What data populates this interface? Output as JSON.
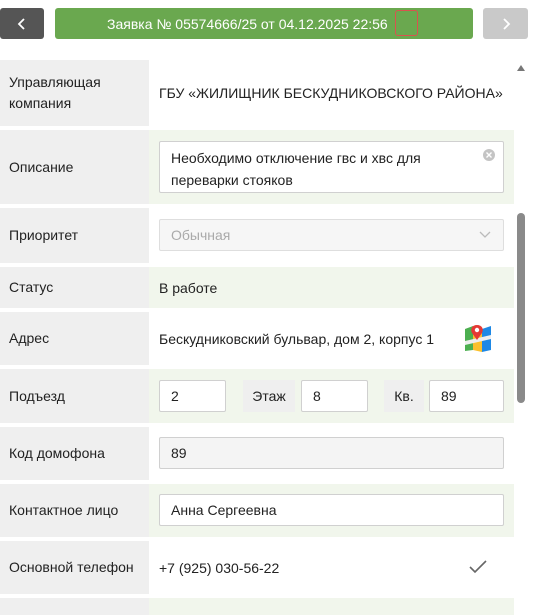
{
  "header": {
    "title": "Заявка № 05574666/25 от 04.12.2025 22:56",
    "back_icon": "chevron-left-icon",
    "forward_icon": "chevron-right-icon"
  },
  "form": {
    "company": {
      "label": "Управляющая компания",
      "value": "ГБУ «ЖИЛИЩНИК БЕСКУДНИКОВСКОГО РАЙОНА»"
    },
    "description": {
      "label": "Описание",
      "value": "Необходимо отключение гвс и хвс для переварки стояков"
    },
    "priority": {
      "label": "Приоритет",
      "value": "Обычная"
    },
    "status": {
      "label": "Статус",
      "value": "В работе"
    },
    "address": {
      "label": "Адрес",
      "value": "Бескудниковский бульвар, дом 2, корпус 1",
      "icon": "map-icon"
    },
    "entrance": {
      "label": "Подъезд",
      "value": "2",
      "floor_label": "Этаж",
      "floor_value": "8",
      "apt_label": "Кв.",
      "apt_value": "89"
    },
    "intercom": {
      "label": "Код домофона",
      "value": "89"
    },
    "contact": {
      "label": "Контактное лицо",
      "value": "Анна Сергеевна"
    },
    "phone": {
      "label": "Основной телефон",
      "value": "+7 (925) 030-56-22",
      "icon": "checkmark-icon"
    }
  },
  "colors": {
    "title_bar": "#6aa84f",
    "back_button": "#555555",
    "forward_button": "#c9c9c9",
    "label_bg": "#efefef",
    "value_bg": "#f1f6ec"
  }
}
